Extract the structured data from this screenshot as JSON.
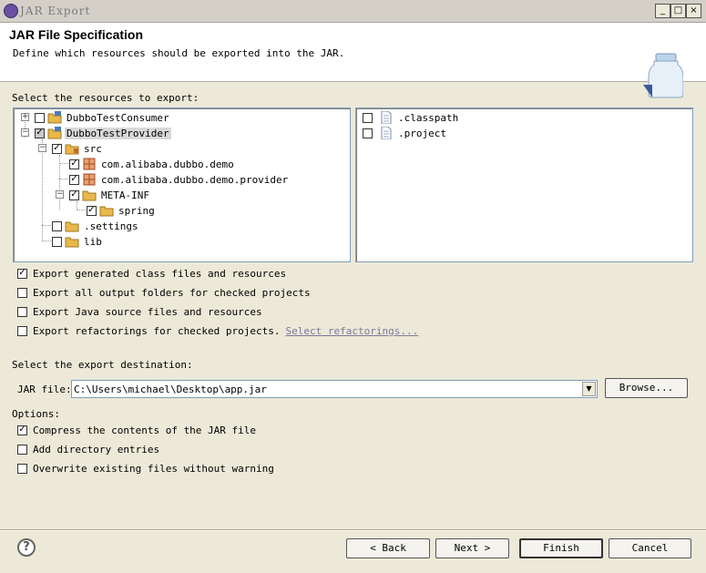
{
  "window": {
    "title": "JAR Export",
    "min_label": "_",
    "max_label": "□",
    "close_label": "×"
  },
  "header": {
    "title": "JAR File Specification",
    "description": "Define which resources should be exported into the JAR."
  },
  "resources": {
    "label": "Select the resources to export:",
    "tree": [
      {
        "label": "DubboTestConsumer",
        "expander": "+",
        "checked": false,
        "icon": "project-icon"
      },
      {
        "label": "DubboTestProvider",
        "expander": "−",
        "checked": "partial",
        "icon": "project-icon",
        "selected": true
      },
      {
        "label": "src",
        "expander": "−",
        "checked": true,
        "icon": "source-folder-icon"
      },
      {
        "label": "com.alibaba.dubbo.demo",
        "checked": true,
        "icon": "package-icon"
      },
      {
        "label": "com.alibaba.dubbo.demo.provider",
        "checked": true,
        "icon": "package-icon"
      },
      {
        "label": "META-INF",
        "expander": "−",
        "checked": true,
        "icon": "folder-icon"
      },
      {
        "label": "spring",
        "checked": true,
        "icon": "folder-icon"
      },
      {
        "label": ".settings",
        "checked": false,
        "icon": "folder-icon"
      },
      {
        "label": "lib",
        "checked": false,
        "icon": "folder-icon"
      }
    ],
    "files": [
      {
        "label": ".classpath",
        "checked": false,
        "icon": "file-icon"
      },
      {
        "label": ".project",
        "checked": false,
        "icon": "file-icon"
      }
    ]
  },
  "export_options": [
    {
      "label": "Export generated class files and resources",
      "checked": true
    },
    {
      "label": "Export all output folders for checked projects",
      "checked": false
    },
    {
      "label": "Export Java source files and resources",
      "checked": false
    },
    {
      "label": "Export refactorings for checked projects.",
      "checked": false,
      "link": "Select refactorings..."
    }
  ],
  "destination": {
    "label": "Select the export destination:",
    "jar_label": "JAR file:",
    "jar_value": "C:\\Users\\michael\\Desktop\\app.jar",
    "browse_label": "Browse..."
  },
  "options": {
    "label": "Options:",
    "items": [
      {
        "label": "Compress the contents of the JAR file",
        "checked": true
      },
      {
        "label": "Add directory entries",
        "checked": false
      },
      {
        "label": "Overwrite existing files without warning",
        "checked": false
      }
    ]
  },
  "footer": {
    "help": "?",
    "back": "< Back",
    "next": "Next >",
    "finish": "Finish",
    "cancel": "Cancel"
  },
  "colors": {
    "folder": "#e8b84a",
    "package": "#c06a30",
    "project": "#4a7ab8"
  }
}
